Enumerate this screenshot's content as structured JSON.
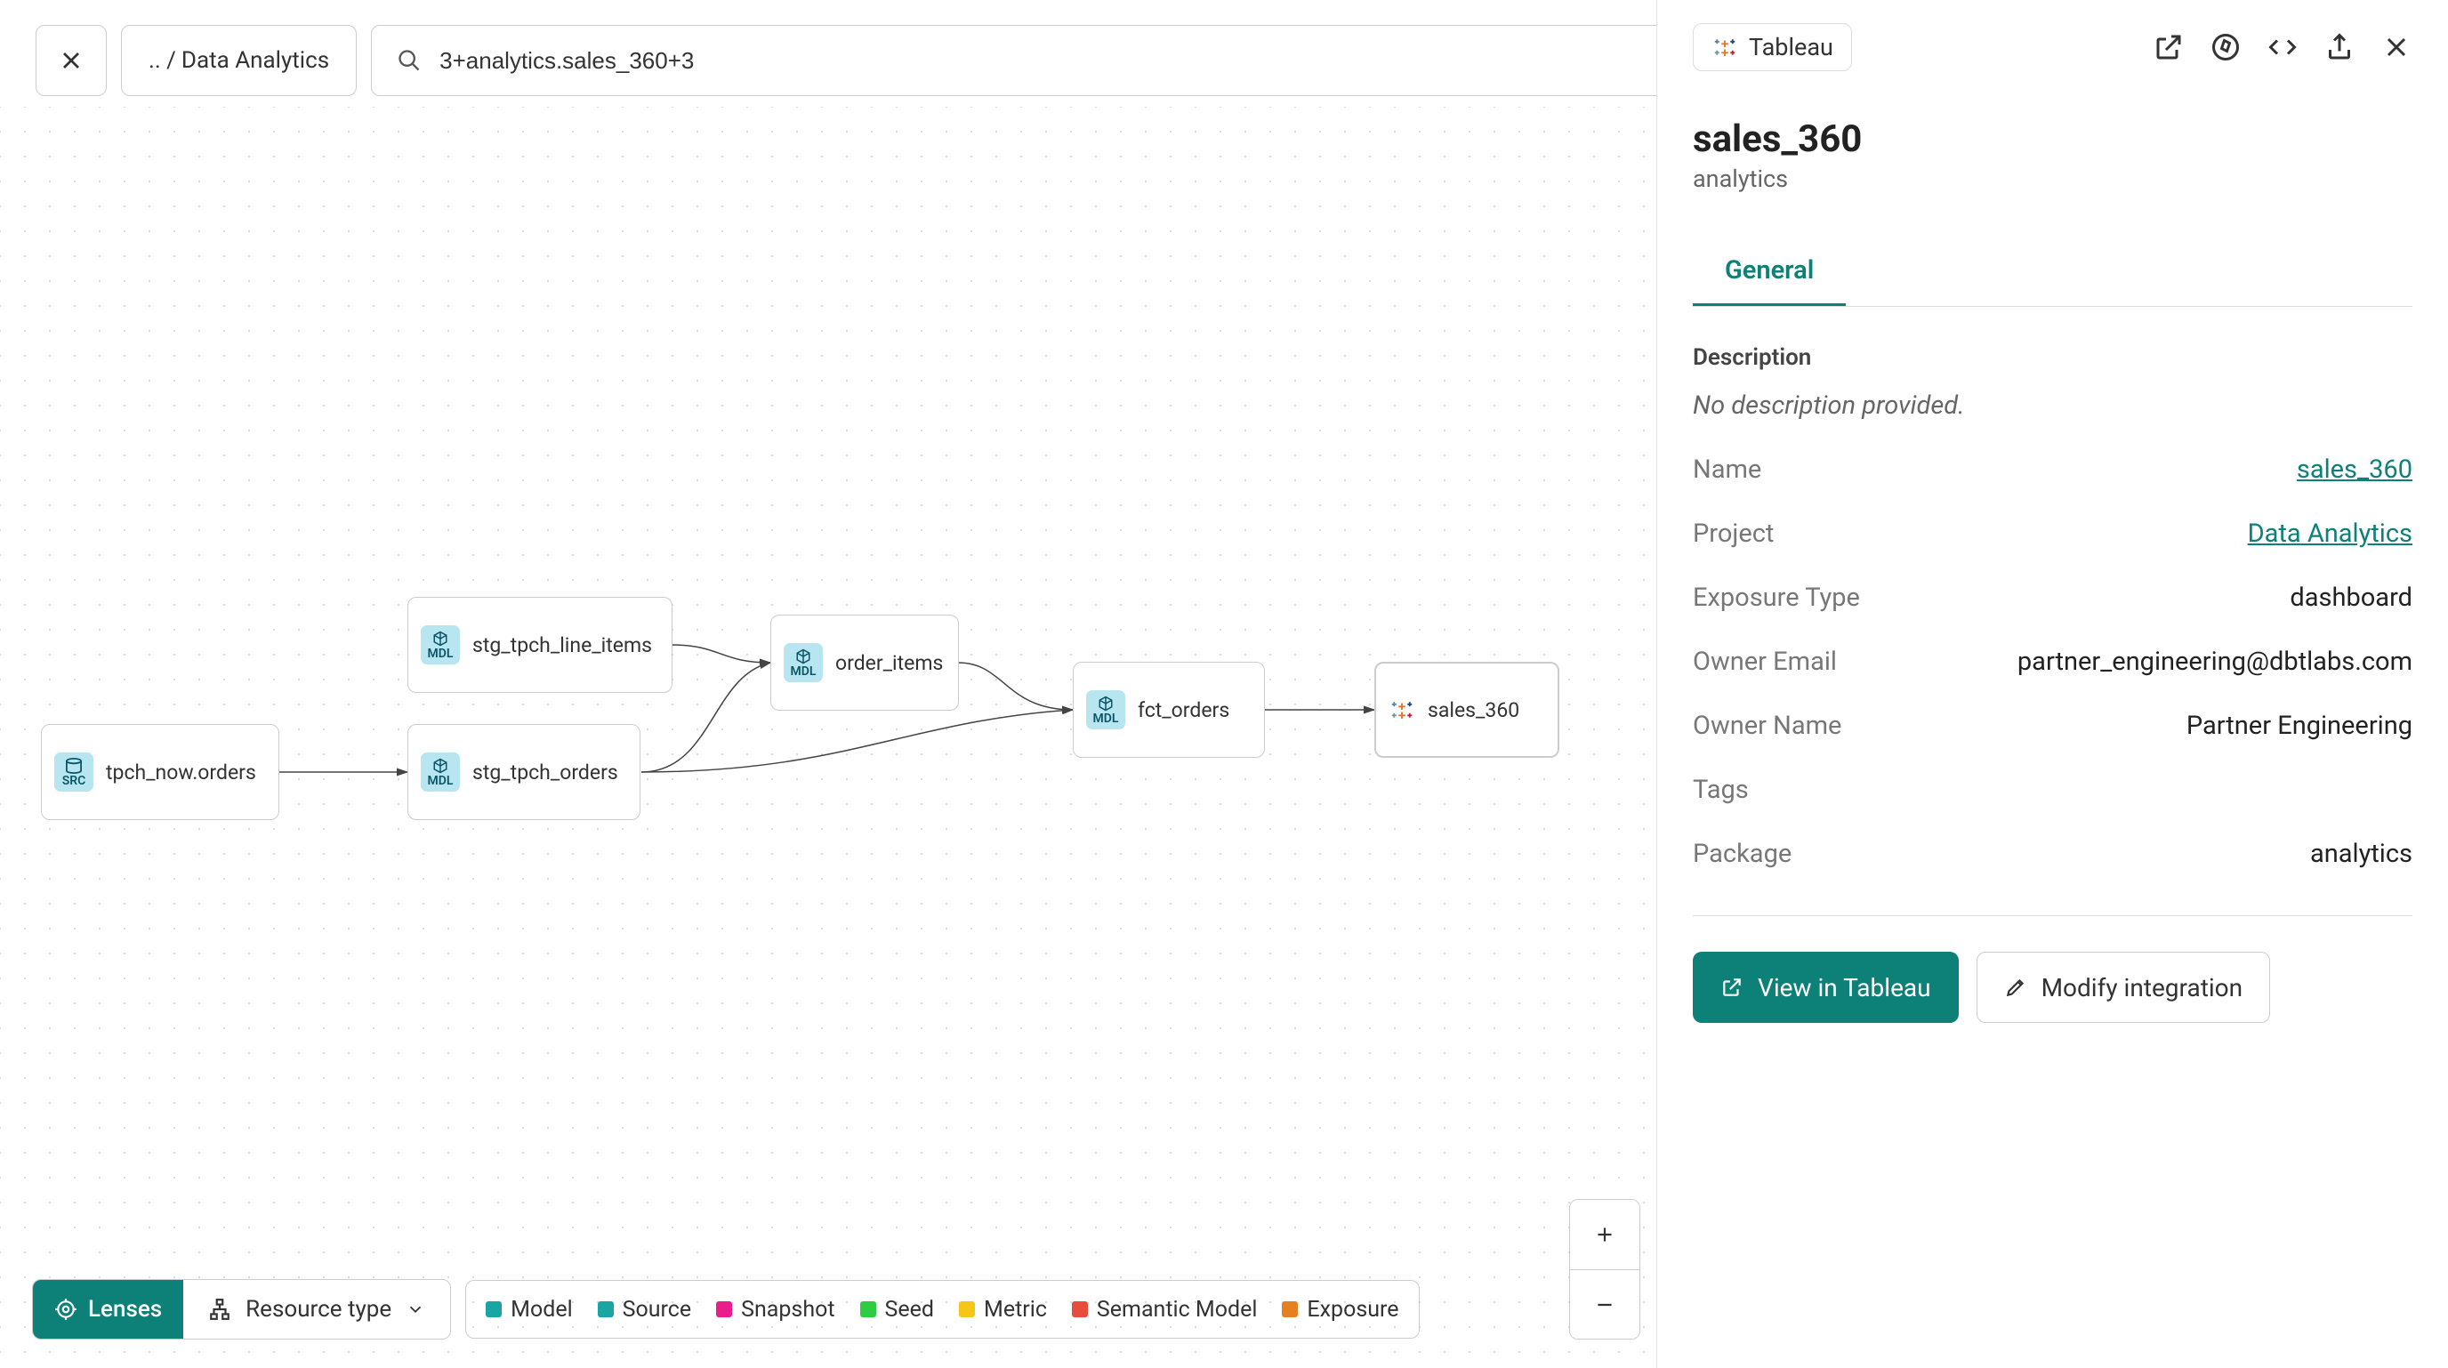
{
  "toolbar": {
    "breadcrumb_prefix": ".. /",
    "breadcrumb_label": "Data Analytics",
    "search_value": "3+analytics.sales_360+3"
  },
  "nodes": {
    "src_orders": {
      "type": "SRC",
      "label": "tpch_now.orders"
    },
    "stg_line_items": {
      "type": "MDL",
      "label": "stg_tpch_line_items"
    },
    "stg_orders": {
      "type": "MDL",
      "label": "stg_tpch_orders"
    },
    "order_items": {
      "type": "MDL",
      "label": "order_items"
    },
    "fct_orders": {
      "type": "MDL",
      "label": "fct_orders"
    },
    "sales_360": {
      "label": "sales_360"
    }
  },
  "bottom": {
    "lenses_label": "Lenses",
    "resource_type_label": "Resource type",
    "legend": {
      "model": "Model",
      "source": "Source",
      "snapshot": "Snapshot",
      "seed": "Seed",
      "metric": "Metric",
      "semantic_model": "Semantic Model",
      "exposure": "Exposure"
    }
  },
  "legend_colors": {
    "model": "#1aa5a5",
    "source": "#1aa5a5",
    "snapshot": "#e91e8c",
    "seed": "#2ecc40",
    "metric": "#f5c518",
    "semantic_model": "#e74c3c",
    "exposure": "#e67e22"
  },
  "sidebar": {
    "chip_label": "Tableau",
    "title": "sales_360",
    "subtitle": "analytics",
    "tab_general": "General",
    "description_label": "Description",
    "description_value": "No description provided.",
    "fields": {
      "name_key": "Name",
      "name_val": "sales_360",
      "project_key": "Project",
      "project_val": "Data Analytics",
      "exposure_type_key": "Exposure Type",
      "exposure_type_val": "dashboard",
      "owner_email_key": "Owner Email",
      "owner_email_val": "partner_engineering@dbtlabs.com",
      "owner_name_key": "Owner Name",
      "owner_name_val": "Partner Engineering",
      "tags_key": "Tags",
      "tags_val": "",
      "package_key": "Package",
      "package_val": "analytics"
    },
    "btn_view": "View in Tableau",
    "btn_modify": "Modify integration"
  }
}
